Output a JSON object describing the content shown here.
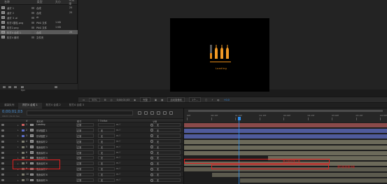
{
  "project": {
    "columns": [
      "名称",
      "类型",
      "大小",
      "帧速率"
    ],
    "items": [
      {
        "name": "卤灯 1",
        "type": "合成",
        "size": "",
        "fps": "25"
      },
      {
        "name": "卤灯 2",
        "type": "合成",
        "size": "",
        "fps": "25"
      },
      {
        "name": "卤灯 3 .ai",
        "type": "AI",
        "size": "",
        "fps": ""
      },
      {
        "name": "阶打1整柱.png",
        "type": "PNG 文件",
        "size": "1 KB",
        "fps": ""
      },
      {
        "name": "阶打2.png",
        "type": "PNG 文件",
        "size": "1 KB",
        "fps": ""
      },
      {
        "name": "阶打4 合成 1",
        "type": "合成",
        "size": "",
        "fps": "25",
        "selected": true
      },
      {
        "name": "阶打4 素材",
        "type": "文件夹",
        "size": "",
        "fps": ""
      }
    ],
    "bpc": "8 bpc"
  },
  "viewer": {
    "loading_text": "Loading",
    "zoom": "50%",
    "timecode": "0;00;01;03",
    "quality": "完整",
    "camera": "活动摄像机",
    "views": "1个...",
    "offset": "+0.0",
    "colors": {
      "orange": "#e68a19",
      "blue": "#2d8ceb",
      "annotation": "#e02020"
    }
  },
  "timeline": {
    "tabs": [
      "渲染队列",
      "阶打4 合成 1",
      "阶打4 合成 2",
      "阶打4 合成 3"
    ],
    "timecode": "0;00;01;03",
    "frame_info": "00033 (30.00 fps)",
    "columns": {
      "num": "#",
      "name": "源名称",
      "mode": "模式",
      "trk": "T TrkMat",
      "parent": "父级"
    },
    "ruler_ticks": [
      "00f",
      "00:15f",
      "01:00f",
      "01:15f",
      "02:00f",
      "02:15f",
      "03:00f",
      "03:15f",
      "04:00f"
    ],
    "layers": [
      {
        "num": "1",
        "name": "Loading",
        "mode": "正常",
        "trk": "",
        "parent": "无",
        "color": "#c75d5d"
      },
      {
        "num": "2",
        "name": "形状图层 1",
        "mode": "正常",
        "trk": "无",
        "parent": "无",
        "color": "#5d6ec7"
      },
      {
        "num": "3",
        "name": "形状图层 2",
        "mode": "正常",
        "trk": "无",
        "parent": "无",
        "color": "#5d6ec7"
      },
      {
        "num": "4",
        "name": "瓶身素材 2",
        "mode": "正常",
        "trk": "无",
        "parent": "无",
        "color": "#7b7b6e"
      },
      {
        "num": "5",
        "name": "瓶身素材 3",
        "mode": "正常",
        "trk": "无",
        "parent": "无",
        "color": "#7b7b6e"
      },
      {
        "num": "6",
        "name": "瓶身素材 4",
        "mode": "正常",
        "trk": "无",
        "parent": "无",
        "color": "#7b7b6e"
      },
      {
        "num": "7",
        "name": "瓶身素材 5",
        "mode": "正常",
        "trk": "无",
        "parent": "无",
        "color": "#7b7b6e"
      },
      {
        "num": "8",
        "name": "瓶身素材 6",
        "mode": "正常",
        "trk": "无",
        "parent": "无",
        "color": "#7b7b6e"
      },
      {
        "num": "9",
        "name": "瓶身素材 7",
        "mode": "正常",
        "trk": "无",
        "parent": "无",
        "color": "#7b7b6e"
      },
      {
        "num": "10",
        "name": "瓶身素材 8",
        "mode": "正常",
        "trk": "无",
        "parent": "无",
        "color": "#7b7b6e"
      },
      {
        "num": "11",
        "name": "瓶身素材 9",
        "mode": "正常",
        "trk": "无",
        "parent": "无",
        "color": "#7b7b6e"
      }
    ],
    "annotations": {
      "first": "第1帧到第1帧",
      "second": "第5帧到第4帧"
    }
  }
}
